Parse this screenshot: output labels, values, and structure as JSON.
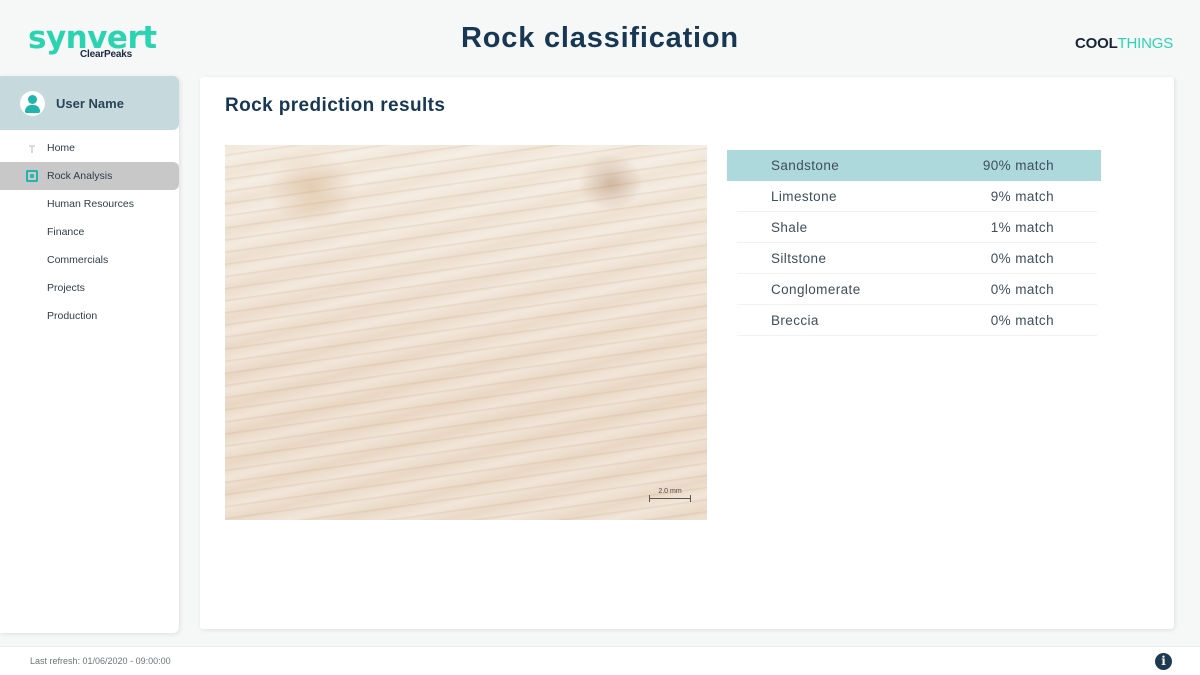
{
  "header": {
    "logo_left": {
      "brand": "synvert",
      "sub": "ClearPeaks"
    },
    "title": "Rock classification",
    "logo_right": {
      "part1": "COOL",
      "part2": "THINGS"
    }
  },
  "sidebar": {
    "user_name": "User Name",
    "items": [
      {
        "label": "Home",
        "icon": "home-icon",
        "active": false
      },
      {
        "label": "Rock Analysis",
        "icon": "scan-icon",
        "active": true
      },
      {
        "label": "Human Resources",
        "active": false
      },
      {
        "label": "Finance",
        "active": false
      },
      {
        "label": "Commercials",
        "active": false
      },
      {
        "label": "Projects",
        "active": false
      },
      {
        "label": "Production",
        "active": false
      }
    ]
  },
  "main": {
    "title": "Rock prediction results",
    "image": {
      "scale_label": "2.0 mm"
    },
    "results": [
      {
        "name": "Sandstone",
        "match": "90% match",
        "highlighted": true
      },
      {
        "name": "Limestone",
        "match": "9% match"
      },
      {
        "name": "Shale",
        "match": "1% match"
      },
      {
        "name": "Siltstone",
        "match": "0% match"
      },
      {
        "name": "Conglomerate",
        "match": "0% match"
      },
      {
        "name": "Breccia",
        "match": "0% match"
      }
    ],
    "highlight_color": "#aed9dc"
  },
  "footer": {
    "last_refresh": "Last refresh: 01/06/2020 - 09:00:00",
    "info_icon": "i"
  },
  "colors": {
    "accent": "#2ad4b0",
    "title": "#173753",
    "teal_icon": "#1fb5ad"
  }
}
